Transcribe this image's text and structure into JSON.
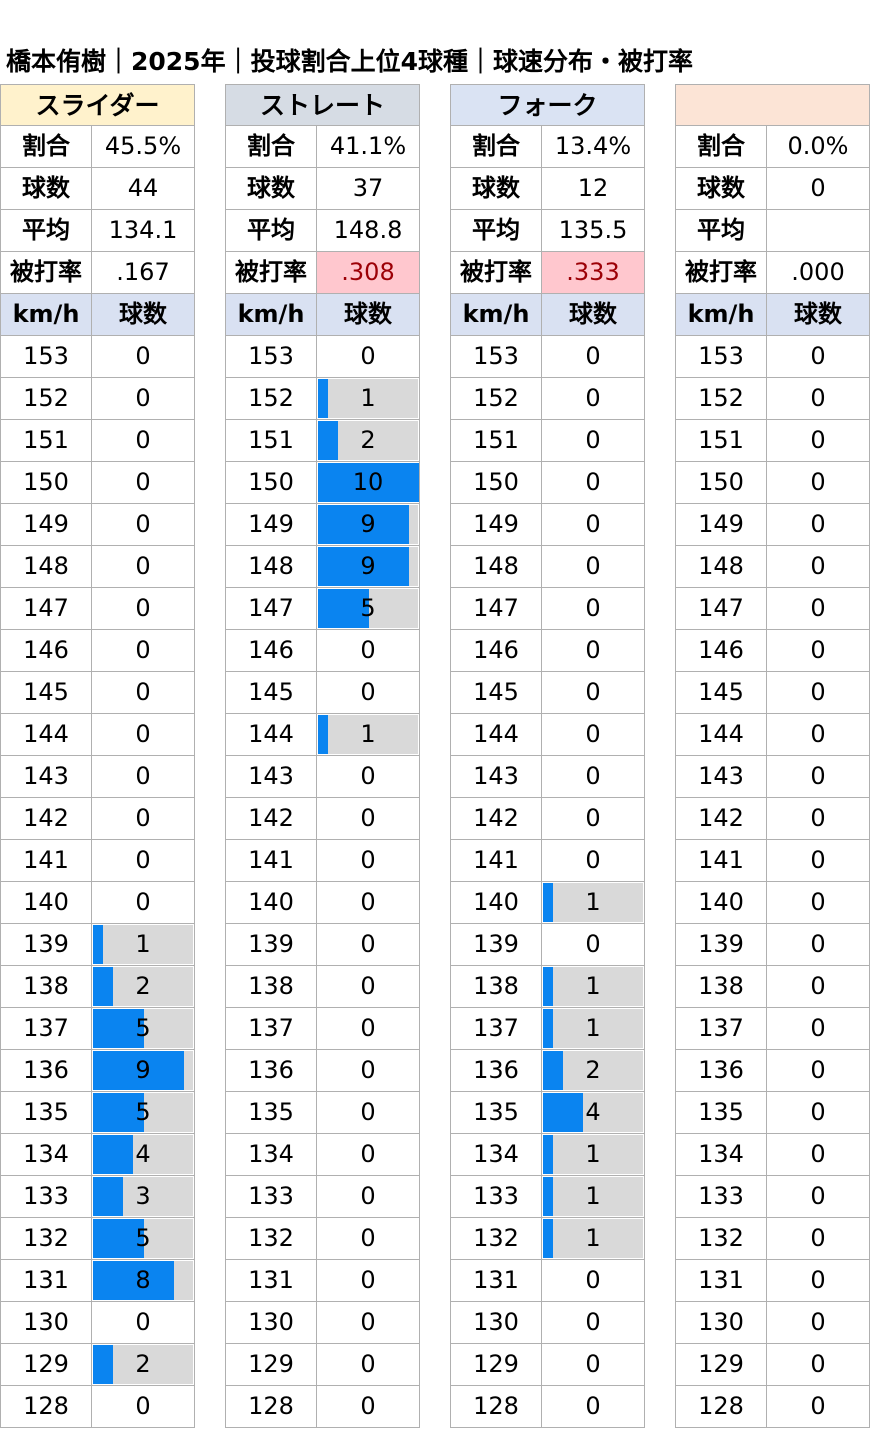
{
  "title": "橋本侑樹｜2025年｜投球割合上位4球種｜球速分布・被打率",
  "labels": {
    "ratio": "割合",
    "count": "球数",
    "avg": "平均",
    "hit": "被打率",
    "kmh": "km/h",
    "col_count": "球数"
  },
  "speeds": [
    153,
    152,
    151,
    150,
    149,
    148,
    147,
    146,
    145,
    144,
    143,
    142,
    141,
    140,
    139,
    138,
    137,
    136,
    135,
    134,
    133,
    132,
    131,
    130,
    129,
    128
  ],
  "colors": {
    "slider_head": "#fff2cc",
    "straight_head": "#d6dce4",
    "fork_head": "#dae3f3",
    "empty_head": "#fce4d6",
    "bar": "#0a84f0",
    "bar_bg": "#d9d9d9",
    "hit_red_bg": "#ffc7ce",
    "hit_red_text": "#9c0006"
  },
  "bar_max": 10,
  "pitches": [
    {
      "name": "スライダー",
      "ratio": "45.5%",
      "count": "44",
      "avg": "134.1",
      "hit": ".167",
      "hit_highlight": false,
      "dist": [
        0,
        0,
        0,
        0,
        0,
        0,
        0,
        0,
        0,
        0,
        0,
        0,
        0,
        0,
        1,
        2,
        5,
        9,
        5,
        4,
        3,
        5,
        8,
        0,
        2,
        0
      ]
    },
    {
      "name": "ストレート",
      "ratio": "41.1%",
      "count": "37",
      "avg": "148.8",
      "hit": ".308",
      "hit_highlight": true,
      "dist": [
        0,
        1,
        2,
        10,
        9,
        9,
        5,
        0,
        0,
        1,
        0,
        0,
        0,
        0,
        0,
        0,
        0,
        0,
        0,
        0,
        0,
        0,
        0,
        0,
        0,
        0
      ]
    },
    {
      "name": "フォーク",
      "ratio": "13.4%",
      "count": "12",
      "avg": "135.5",
      "hit": ".333",
      "hit_highlight": true,
      "dist": [
        0,
        0,
        0,
        0,
        0,
        0,
        0,
        0,
        0,
        0,
        0,
        0,
        0,
        1,
        0,
        1,
        1,
        2,
        4,
        1,
        1,
        1,
        0,
        0,
        0,
        0
      ]
    },
    {
      "name": "",
      "ratio": "0.0%",
      "count": "0",
      "avg": "",
      "hit": ".000",
      "hit_highlight": false,
      "dist": [
        0,
        0,
        0,
        0,
        0,
        0,
        0,
        0,
        0,
        0,
        0,
        0,
        0,
        0,
        0,
        0,
        0,
        0,
        0,
        0,
        0,
        0,
        0,
        0,
        0,
        0
      ]
    }
  ]
}
